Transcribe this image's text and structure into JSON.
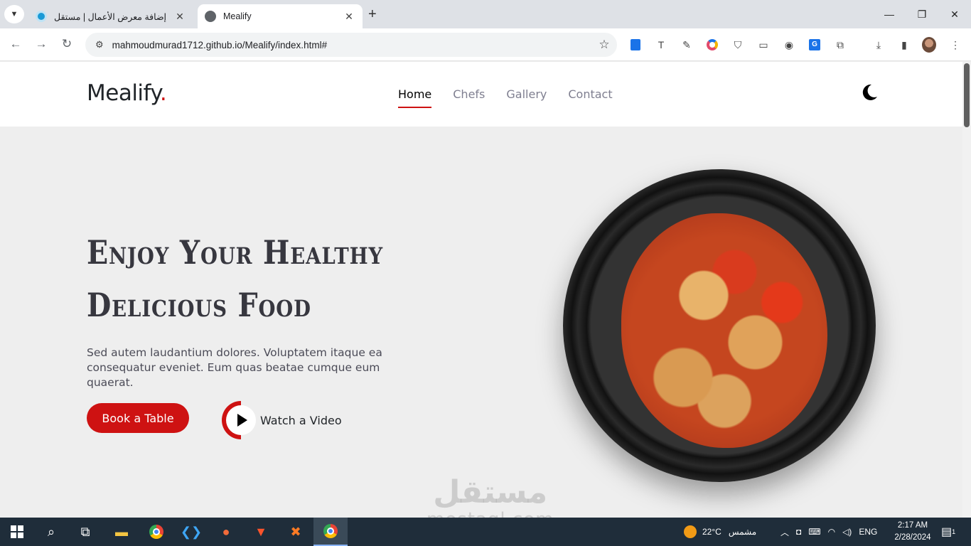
{
  "browser": {
    "tabs": [
      {
        "title": "إضافة معرض الأعمال | مستقل",
        "active": false
      },
      {
        "title": "Mealify",
        "active": true
      }
    ],
    "url": "mahmoudmurad1712.github.io/Mealify/index.html#",
    "new_tab_glyph": "+",
    "close_glyph": "✕"
  },
  "site": {
    "logo_text": "Mealify",
    "logo_dot": ".",
    "nav": [
      {
        "label": "Home",
        "active": true
      },
      {
        "label": "Chefs",
        "active": false
      },
      {
        "label": "Gallery",
        "active": false
      },
      {
        "label": "Contact",
        "active": false
      }
    ],
    "hero": {
      "title_line1": "Enjoy Your Healthy",
      "title_line2": "Delicious Food",
      "description": "Sed autem laudantium dolores. Voluptatem itaque ea consequatur eveniet. Eum quas beatae cumque eum quaerat.",
      "book_button": "Book a Table",
      "watch_label": "Watch a Video"
    },
    "accent_color": "#ce1212"
  },
  "watermark": {
    "arabic": "مستقل",
    "latin": "mostaql.com"
  },
  "taskbar": {
    "weather_temp": "22°C",
    "weather_text": "مشمس",
    "language": "ENG",
    "time": "2:17 AM",
    "date": "2/28/2024",
    "notification_count": "1"
  }
}
